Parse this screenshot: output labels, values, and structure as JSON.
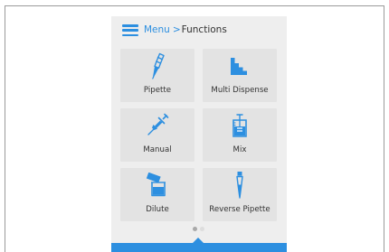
{
  "header": {
    "menu_label": "Menu",
    "separator": ">",
    "current_label": "Functions"
  },
  "tiles": [
    {
      "label": "Pipette",
      "icon": "pipette-icon"
    },
    {
      "label": "Multi Dispense",
      "icon": "multi-dispense-icon"
    },
    {
      "label": "Manual",
      "icon": "manual-syringe-icon"
    },
    {
      "label": "Mix",
      "icon": "mix-icon"
    },
    {
      "label": "Dilute",
      "icon": "dilute-icon"
    },
    {
      "label": "Reverse Pipette",
      "icon": "reverse-pipette-icon"
    }
  ],
  "pager": {
    "pages": 2,
    "current_page": 1
  },
  "colors": {
    "accent": "#2d8fe0",
    "tile_bg": "#e3e3e3",
    "panel_bg": "#eeeeee",
    "text": "#333333"
  }
}
